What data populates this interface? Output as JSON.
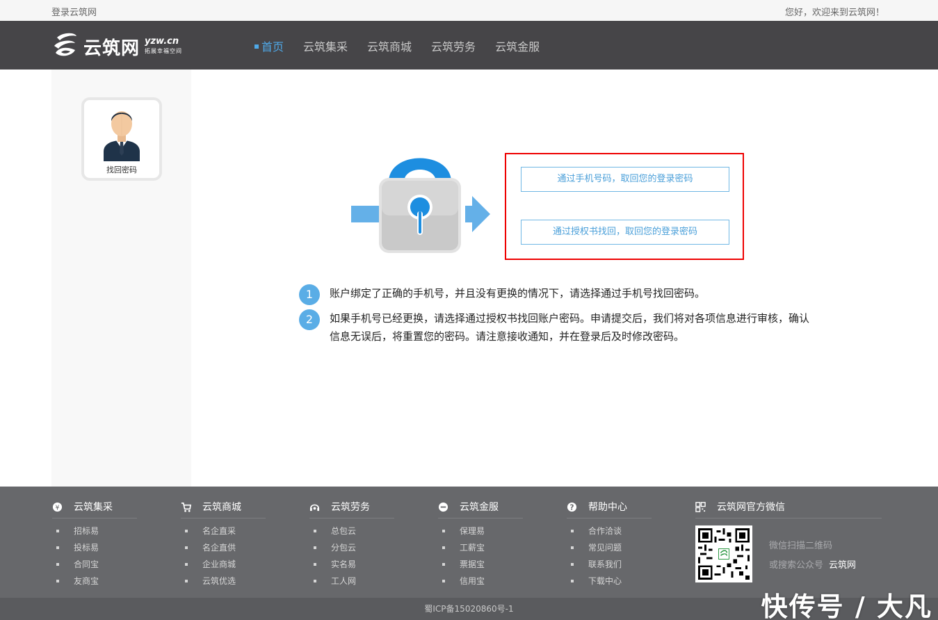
{
  "topbar": {
    "login_link": "登录云筑网",
    "welcome": "您好，欢迎来到云筑网！"
  },
  "header": {
    "brand": "云筑网",
    "domain": "yzw.cn",
    "slogan": "拓展幸福空间",
    "nav": [
      {
        "label": "首页",
        "active": true
      },
      {
        "label": "云筑集采",
        "active": false
      },
      {
        "label": "云筑商城",
        "active": false
      },
      {
        "label": "云筑劳务",
        "active": false
      },
      {
        "label": "云筑金服",
        "active": false
      }
    ]
  },
  "sidebar": {
    "card_label": "找回密码"
  },
  "recovery": {
    "phone_button": "通过手机号码，取回您的登录密码",
    "auth_button": "通过授权书找回，取回您的登录密码",
    "highlight_color": "#ee0000"
  },
  "notes": [
    {
      "num": "1",
      "text": "账户绑定了正确的手机号，并且没有更换的情况下，请选择通过手机号找回密码。"
    },
    {
      "num": "2",
      "text": "如果手机号已经更换，请选择通过授权书找回账户密码。申请提交后，我们将对各项信息进行审核，确认信息无误后，将重置您的密码。请注意接收通知，并在登录后及时修改密码。"
    }
  ],
  "footer": {
    "columns": [
      {
        "title": "云筑集采",
        "icon": "procurement-icon",
        "items": [
          "招标易",
          "投标易",
          "合同宝",
          "友商宝"
        ]
      },
      {
        "title": "云筑商城",
        "icon": "cart-icon",
        "items": [
          "名企直采",
          "名企直供",
          "企业商城",
          "云筑优选"
        ]
      },
      {
        "title": "云筑劳务",
        "icon": "headset-icon",
        "items": [
          "总包云",
          "分包云",
          "实名易",
          "工人网"
        ]
      },
      {
        "title": "云筑金服",
        "icon": "finance-icon",
        "items": [
          "保理易",
          "工薪宝",
          "票据宝",
          "信用宝"
        ]
      },
      {
        "title": "帮助中心",
        "icon": "help-icon",
        "items": [
          "合作洽谈",
          "常见问题",
          "联系我们",
          "下载中心"
        ]
      }
    ],
    "wechat": {
      "title": "云筑网官方微信",
      "scan_text": "微信扫描二维码",
      "search_text": "或搜索公众号",
      "account": "云筑网"
    },
    "icp": "蜀ICP备15020860号-1"
  },
  "watermark": "快传号 / 大凡",
  "colors": {
    "accent": "#4fa9e8",
    "header_bg": "#464548",
    "footer_bg": "#67686b"
  }
}
